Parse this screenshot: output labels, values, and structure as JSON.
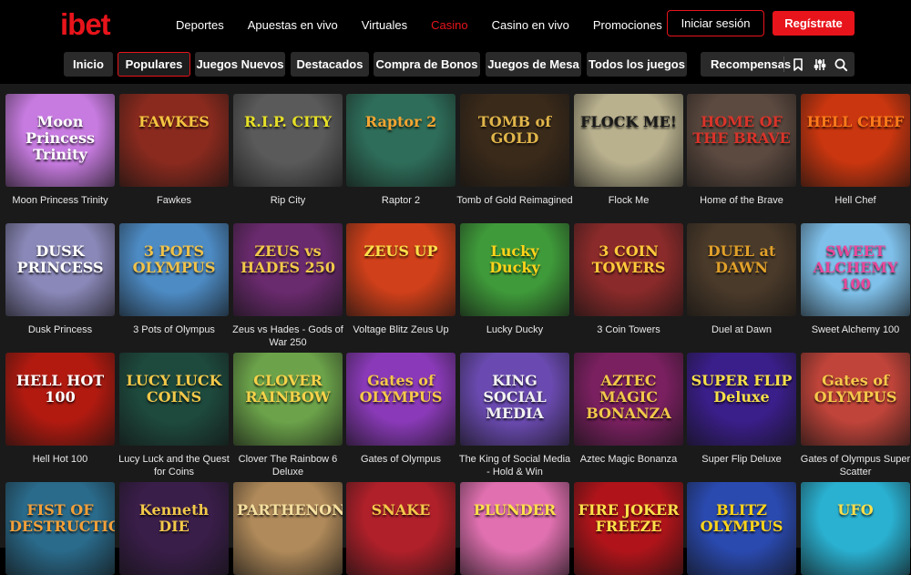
{
  "brand": {
    "logo": "ibet",
    "accent": "#e8141b"
  },
  "nav": [
    "Deportes",
    "Apuestas en vivo",
    "Virtuales",
    "Casino",
    "Casino en vivo",
    "Promociones"
  ],
  "nav_active": "Casino",
  "auth": {
    "login": "Iniciar sesión",
    "register": "Regístrate"
  },
  "filters": [
    "Inicio",
    "Populares",
    "Juegos Nuevos",
    "Destacados",
    "Compra de Bonos",
    "Juegos de Mesa",
    "Todos los juegos"
  ],
  "filter_active": "Populares",
  "tools": {
    "rewards": "Recompensas",
    "icons": [
      "bookmark-icon",
      "sliders-icon",
      "search-icon"
    ]
  },
  "games": [
    {
      "name": "Moon Princess Trinity",
      "art": "Moon Princess Trinity",
      "bg": "#c77be0",
      "fg": "#ffffff"
    },
    {
      "name": "Fawkes",
      "art": "FAWKES",
      "bg": "#8a2a1e",
      "fg": "#f6c541"
    },
    {
      "name": "Rip City",
      "art": "R.I.P. CITY",
      "bg": "#5a5a5a",
      "fg": "#e6e027"
    },
    {
      "name": "Raptor 2",
      "art": "Raptor 2",
      "bg": "#2e6d59",
      "fg": "#f2a532"
    },
    {
      "name": "Tomb of Gold Reimagined",
      "art": "TOMB of GOLD",
      "bg": "#3a2a1a",
      "fg": "#e0b54a"
    },
    {
      "name": "Flock Me",
      "art": "FLOCK ME!",
      "bg": "#b9b18e",
      "fg": "#1a1a1a"
    },
    {
      "name": "Home of the Brave",
      "art": "HOME OF THE BRAVE",
      "bg": "#5c4a40",
      "fg": "#d9342a"
    },
    {
      "name": "Hell Chef",
      "art": "HELL CHEF",
      "bg": "#c9360f",
      "fg": "#ff7a1a"
    },
    {
      "name": "Dusk Princess",
      "art": "DUSK PRINCESS",
      "bg": "#8a88b8",
      "fg": "#ffffff"
    },
    {
      "name": "3 Pots of Olympus",
      "art": "3 POTS OLYMPUS",
      "bg": "#4d8bc4",
      "fg": "#f0c24a"
    },
    {
      "name": "Zeus vs Hades - Gods of War 250",
      "art": "ZEUS vs HADES 250",
      "bg": "#6a2a6e",
      "fg": "#f2c84a"
    },
    {
      "name": "Voltage Blitz Zeus Up",
      "art": "ZEUS UP",
      "bg": "#d0401a",
      "fg": "#ffe04a"
    },
    {
      "name": "Lucky Ducky",
      "art": "Lucky Ducky",
      "bg": "#3f9b3a",
      "fg": "#ffd41a"
    },
    {
      "name": "3 Coin Towers",
      "art": "3 COIN TOWERS",
      "bg": "#8a2a2a",
      "fg": "#ffc93a"
    },
    {
      "name": "Duel at Dawn",
      "art": "DUEL at DAWN",
      "bg": "#4a3a2a",
      "fg": "#e0a02a"
    },
    {
      "name": "Sweet Alchemy 100",
      "art": "SWEET ALCHEMY 100",
      "bg": "#7fc0ea",
      "fg": "#e8489a"
    },
    {
      "name": "Hell Hot 100",
      "art": "HELL HOT 100",
      "bg": "#b21a10",
      "fg": "#ffffff"
    },
    {
      "name": "Lucy Luck and the Quest for Coins",
      "art": "LUCY LUCK COINS",
      "bg": "#1e4a3e",
      "fg": "#f2c84a"
    },
    {
      "name": "Clover The Rainbow 6 Deluxe",
      "art": "CLOVER RAINBOW",
      "bg": "#6ca34a",
      "fg": "#f6d24a"
    },
    {
      "name": "Gates of Olympus",
      "art": "Gates of OLYMPUS",
      "bg": "#8a3ab8",
      "fg": "#f6c84a"
    },
    {
      "name": "The King of Social Media - Hold & Win",
      "art": "KING SOCIAL MEDIA",
      "bg": "#6a4ab0",
      "fg": "#f2f2f2"
    },
    {
      "name": "Aztec Magic Bonanza",
      "art": "AZTEC MAGIC BONANZA",
      "bg": "#7a2060",
      "fg": "#f2c84a"
    },
    {
      "name": "Super Flip Deluxe",
      "art": "SUPER FLIP Deluxe",
      "bg": "#3a1e8a",
      "fg": "#f6e04a"
    },
    {
      "name": "Gates of Olympus Super Scatter",
      "art": "Gates of OLYMPUS",
      "bg": "#c0443a",
      "fg": "#f6c84a"
    },
    {
      "name": "",
      "art": "FIST OF DESTRUCTION",
      "bg": "#2a6a8a",
      "fg": "#f2a03a"
    },
    {
      "name": "",
      "art": "Kenneth DIE",
      "bg": "#3a1e4a",
      "fg": "#f2c84a"
    },
    {
      "name": "",
      "art": "PARTHENON",
      "bg": "#b08a5a",
      "fg": "#f6e0a0"
    },
    {
      "name": "",
      "art": "SNAKE",
      "bg": "#b0202a",
      "fg": "#f6c84a"
    },
    {
      "name": "",
      "art": "PLUNDER",
      "bg": "#e070b0",
      "fg": "#ffe04a"
    },
    {
      "name": "",
      "art": "FIRE JOKER FREEZE",
      "bg": "#b0141a",
      "fg": "#ffe04a"
    },
    {
      "name": "",
      "art": "BLITZ OLYMPUS",
      "bg": "#2a4ab0",
      "fg": "#ffd41a"
    },
    {
      "name": "",
      "art": "UFO",
      "bg": "#2ab0d0",
      "fg": "#ffe04a"
    }
  ]
}
